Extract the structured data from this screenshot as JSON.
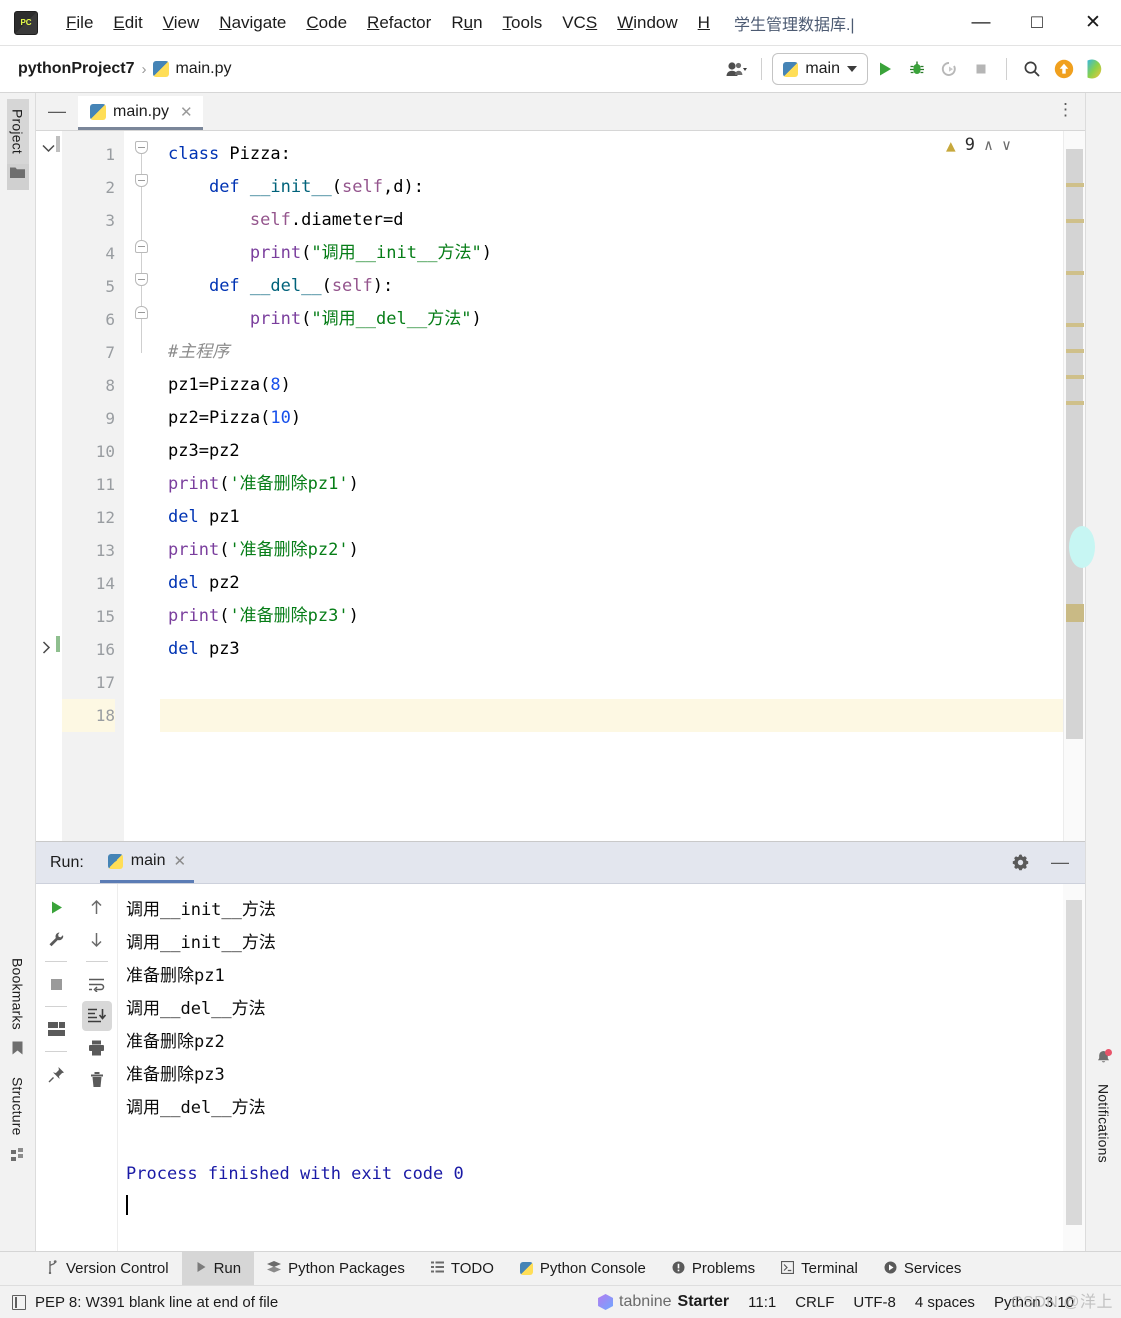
{
  "window": {
    "title": "学生管理数据库.|",
    "app_icon": "pycharm-logo",
    "minimize": "—",
    "maximize": "□",
    "close": "✕"
  },
  "menu": [
    {
      "label": "File",
      "mnemonic": "F"
    },
    {
      "label": "Edit",
      "mnemonic": "E"
    },
    {
      "label": "View",
      "mnemonic": "V"
    },
    {
      "label": "Navigate",
      "mnemonic": "N"
    },
    {
      "label": "Code",
      "mnemonic": "C"
    },
    {
      "label": "Refactor",
      "mnemonic": "R"
    },
    {
      "label": "Run",
      "mnemonic": "u"
    },
    {
      "label": "Tools",
      "mnemonic": "T"
    },
    {
      "label": "VCS",
      "mnemonic": "S"
    },
    {
      "label": "Window",
      "mnemonic": "W"
    },
    {
      "label": "H",
      "mnemonic": "H"
    }
  ],
  "navbar": {
    "project": "pythonProject7",
    "separator": "›",
    "file": "main.py",
    "run_config": "main",
    "icons": [
      "people-icon",
      "run-icon",
      "debug-icon",
      "coverage-icon",
      "stop-icon",
      "search-icon",
      "update-icon",
      "ide-icon"
    ]
  },
  "left_strip": [
    {
      "label": "Project",
      "icon": "folder-icon",
      "active": true
    },
    {
      "label": "Bookmarks",
      "icon": "bookmark-icon",
      "active": false
    },
    {
      "label": "Structure",
      "icon": "structure-icon",
      "active": false
    }
  ],
  "right_strip": [
    {
      "label": "Notifications",
      "icon": "bell-icon"
    }
  ],
  "editor": {
    "tab": {
      "label": "main.py",
      "close": "✕"
    },
    "more_menu": "⋮",
    "warning_count": "9",
    "warning_icon": "warning-triangle-icon",
    "prev_icon": "∧",
    "next_icon": "∨",
    "hide_icon": "—",
    "lines": [
      {
        "n": "1",
        "tokens": [
          {
            "t": "class ",
            "c": "k"
          },
          {
            "t": "Pizza",
            "c": "pl"
          },
          {
            "t": ":",
            "c": "pl"
          }
        ]
      },
      {
        "n": "2",
        "tokens": [
          {
            "t": "    ",
            "c": "pl"
          },
          {
            "t": "def ",
            "c": "k"
          },
          {
            "t": "__init__",
            "c": "fn"
          },
          {
            "t": "(",
            "c": "pl"
          },
          {
            "t": "self",
            "c": "sf"
          },
          {
            "t": ",d",
            "c": "pl"
          },
          {
            "t": "):",
            "c": "pl"
          }
        ]
      },
      {
        "n": "3",
        "tokens": [
          {
            "t": "        ",
            "c": "pl"
          },
          {
            "t": "self",
            "c": "sf"
          },
          {
            "t": ".diameter=d",
            "c": "pl"
          }
        ]
      },
      {
        "n": "4",
        "tokens": [
          {
            "t": "        ",
            "c": "pl"
          },
          {
            "t": "print",
            "c": "bi"
          },
          {
            "t": "(",
            "c": "pl"
          },
          {
            "t": "\"调用__init__方法\"",
            "c": "st"
          },
          {
            "t": ")",
            "c": "pl"
          }
        ]
      },
      {
        "n": "5",
        "tokens": [
          {
            "t": "    ",
            "c": "pl"
          },
          {
            "t": "def ",
            "c": "k"
          },
          {
            "t": "__del__",
            "c": "fn"
          },
          {
            "t": "(",
            "c": "pl"
          },
          {
            "t": "self",
            "c": "sf"
          },
          {
            "t": "):",
            "c": "pl"
          }
        ]
      },
      {
        "n": "6",
        "tokens": [
          {
            "t": "        ",
            "c": "pl"
          },
          {
            "t": "print",
            "c": "bi"
          },
          {
            "t": "(",
            "c": "pl"
          },
          {
            "t": "\"调用__del__方法\"",
            "c": "st"
          },
          {
            "t": ")",
            "c": "pl"
          }
        ]
      },
      {
        "n": "7",
        "tokens": [
          {
            "t": "#主程序",
            "c": "cm"
          }
        ]
      },
      {
        "n": "8",
        "tokens": [
          {
            "t": "pz1=Pizza(",
            "c": "pl"
          },
          {
            "t": "8",
            "c": "num"
          },
          {
            "t": ")",
            "c": "pl"
          }
        ]
      },
      {
        "n": "9",
        "tokens": [
          {
            "t": "pz2=Pizza(",
            "c": "pl"
          },
          {
            "t": "10",
            "c": "num"
          },
          {
            "t": ")",
            "c": "pl"
          }
        ]
      },
      {
        "n": "10",
        "tokens": [
          {
            "t": "pz3=pz2",
            "c": "pl"
          }
        ]
      },
      {
        "n": "11",
        "tokens": [
          {
            "t": "print",
            "c": "bi"
          },
          {
            "t": "(",
            "c": "pl"
          },
          {
            "t": "'准备删除pz1'",
            "c": "st"
          },
          {
            "t": ")",
            "c": "pl"
          }
        ]
      },
      {
        "n": "12",
        "tokens": [
          {
            "t": "del ",
            "c": "k"
          },
          {
            "t": "pz1",
            "c": "pl"
          }
        ]
      },
      {
        "n": "13",
        "tokens": [
          {
            "t": "print",
            "c": "bi"
          },
          {
            "t": "(",
            "c": "pl"
          },
          {
            "t": "'准备删除pz2'",
            "c": "st"
          },
          {
            "t": ")",
            "c": "pl"
          }
        ]
      },
      {
        "n": "14",
        "tokens": [
          {
            "t": "del ",
            "c": "k"
          },
          {
            "t": "pz2",
            "c": "pl"
          }
        ]
      },
      {
        "n": "15",
        "tokens": [
          {
            "t": "print",
            "c": "bi"
          },
          {
            "t": "(",
            "c": "pl"
          },
          {
            "t": "'准备删除pz3'",
            "c": "st"
          },
          {
            "t": ")",
            "c": "pl"
          }
        ]
      },
      {
        "n": "16",
        "tokens": [
          {
            "t": "del ",
            "c": "k"
          },
          {
            "t": "pz3",
            "c": "pl"
          }
        ]
      },
      {
        "n": "17",
        "tokens": []
      },
      {
        "n": "18",
        "tokens": [],
        "current": true
      }
    ]
  },
  "run_panel": {
    "label": "Run:",
    "tab": {
      "label": "main",
      "close": "✕",
      "icon": "python-icon"
    },
    "settings_icon": "gear-icon",
    "minimize_icon": "—",
    "side_buttons": [
      "rerun-icon",
      "wrench-icon",
      "stop-icon",
      "layout-icon",
      "pin-icon"
    ],
    "side_buttons2": [
      "up-icon",
      "down-icon",
      "soft-wrap-icon",
      "scroll-to-end-icon",
      "print-icon",
      "trash-icon"
    ],
    "output": [
      {
        "text": "调用__init__方法",
        "style": "plain"
      },
      {
        "text": "调用__init__方法",
        "style": "plain"
      },
      {
        "text": "准备删除pz1",
        "style": "plain"
      },
      {
        "text": "调用__del__方法",
        "style": "plain"
      },
      {
        "text": "准备删除pz2",
        "style": "plain"
      },
      {
        "text": "准备删除pz3",
        "style": "plain"
      },
      {
        "text": "调用__del__方法",
        "style": "plain"
      },
      {
        "text": "",
        "style": "plain"
      },
      {
        "text": "Process finished with exit code 0",
        "style": "blue"
      }
    ]
  },
  "tool_windows": [
    {
      "label": "Version Control",
      "icon": "branch-icon",
      "active": false
    },
    {
      "label": "Run",
      "icon": "run-icon",
      "active": true
    },
    {
      "label": "Python Packages",
      "icon": "packages-icon",
      "active": false
    },
    {
      "label": "TODO",
      "icon": "todo-icon",
      "active": false
    },
    {
      "label": "Python Console",
      "icon": "python-icon",
      "active": false
    },
    {
      "label": "Problems",
      "icon": "problems-icon",
      "active": false
    },
    {
      "label": "Terminal",
      "icon": "terminal-icon",
      "active": false
    },
    {
      "label": "Services",
      "icon": "services-icon",
      "active": false
    }
  ],
  "status_bar": {
    "inspection_icon": "document-icon",
    "message": "PEP 8: W391 blank line at end of file",
    "tabnine": "tabnine",
    "tabnine_plan": "Starter",
    "caret_position": "11:1",
    "line_separator": "CRLF",
    "encoding": "UTF-8",
    "indent": "4 spaces",
    "interpreter": "Python 3.10",
    "watermark": "CSDN @洋上",
    "lock_icon": "lock-icon"
  },
  "colors": {
    "accent": "#5b7cb5",
    "keyword": "#0033b3",
    "string": "#067d17",
    "builtin": "#7a3e9d",
    "number": "#1750eb",
    "comment": "#8c8c8c",
    "self": "#94558d",
    "console_blue": "#1a1aa6",
    "warning": "#c7a83c"
  }
}
